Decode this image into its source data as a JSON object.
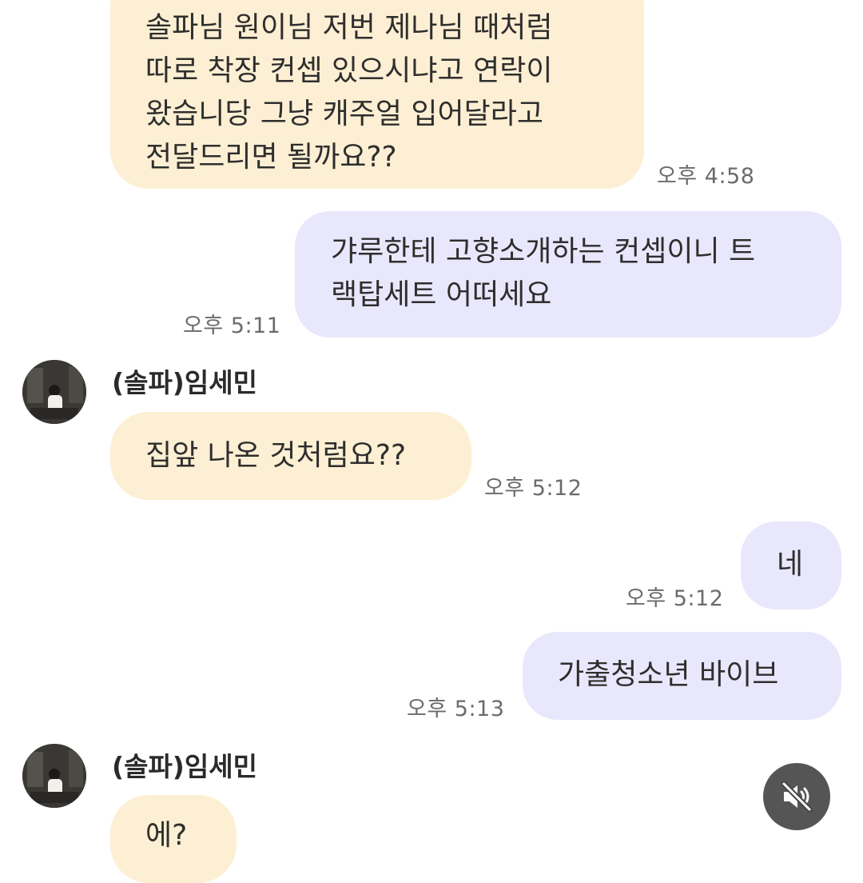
{
  "messages": [
    {
      "id": "m1",
      "direction": "incoming",
      "text": "솔파님 원이님 저번 제나님 때처럼\n따로 착장 컨셉 있으시냐고 연락이\n왔습니당 그냥 캐주얼 입어달라고\n전달드리면 될까요??",
      "time": "오후 4:58"
    },
    {
      "id": "m2",
      "direction": "outgoing",
      "text": "갸루한테 고향소개하는 컨셉이니 트\n랙탑세트 어떠세요",
      "time": "오후 5:11"
    },
    {
      "id": "m3",
      "direction": "incoming",
      "sender": "(솔파)임세민",
      "text": "집앞 나온 것처럼요??",
      "time": "오후 5:12"
    },
    {
      "id": "m4",
      "direction": "outgoing",
      "text": "네",
      "time": "오후 5:12"
    },
    {
      "id": "m5",
      "direction": "outgoing",
      "text": "가출청소년 바이브",
      "time": "오후 5:13"
    },
    {
      "id": "m6",
      "direction": "incoming",
      "sender": "(솔파)임세민",
      "text": "에?",
      "time": ""
    }
  ],
  "colors": {
    "incoming_bubble": "#fdefd3",
    "outgoing_bubble": "#e9e7fb",
    "timestamp": "#6b6b6b",
    "mute_button": "#464646"
  },
  "controls": {
    "mute_icon": "speaker-muted-icon"
  }
}
